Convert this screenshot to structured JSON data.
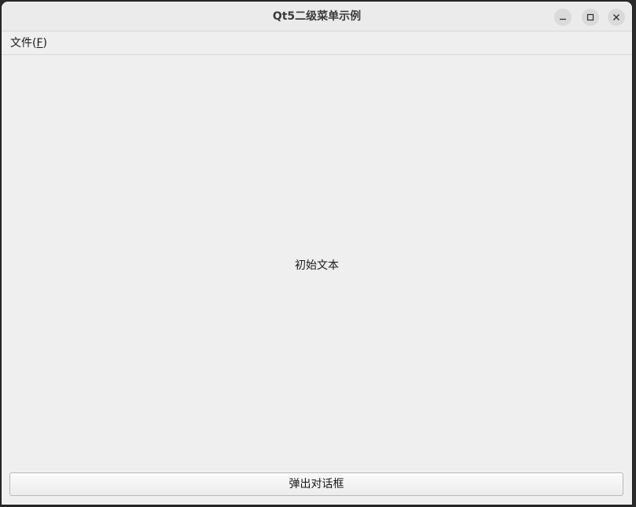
{
  "window": {
    "title": "Qt5二级菜单示例",
    "controls": {
      "minimize": "minimize-icon",
      "maximize": "maximize-icon",
      "close": "close-icon"
    }
  },
  "menubar": {
    "items": [
      {
        "label_prefix": "文件(",
        "mnemonic": "F",
        "label_suffix": ")"
      }
    ]
  },
  "content": {
    "label_text": "初始文本"
  },
  "actions": {
    "dialog_button": "弹出对话框"
  }
}
